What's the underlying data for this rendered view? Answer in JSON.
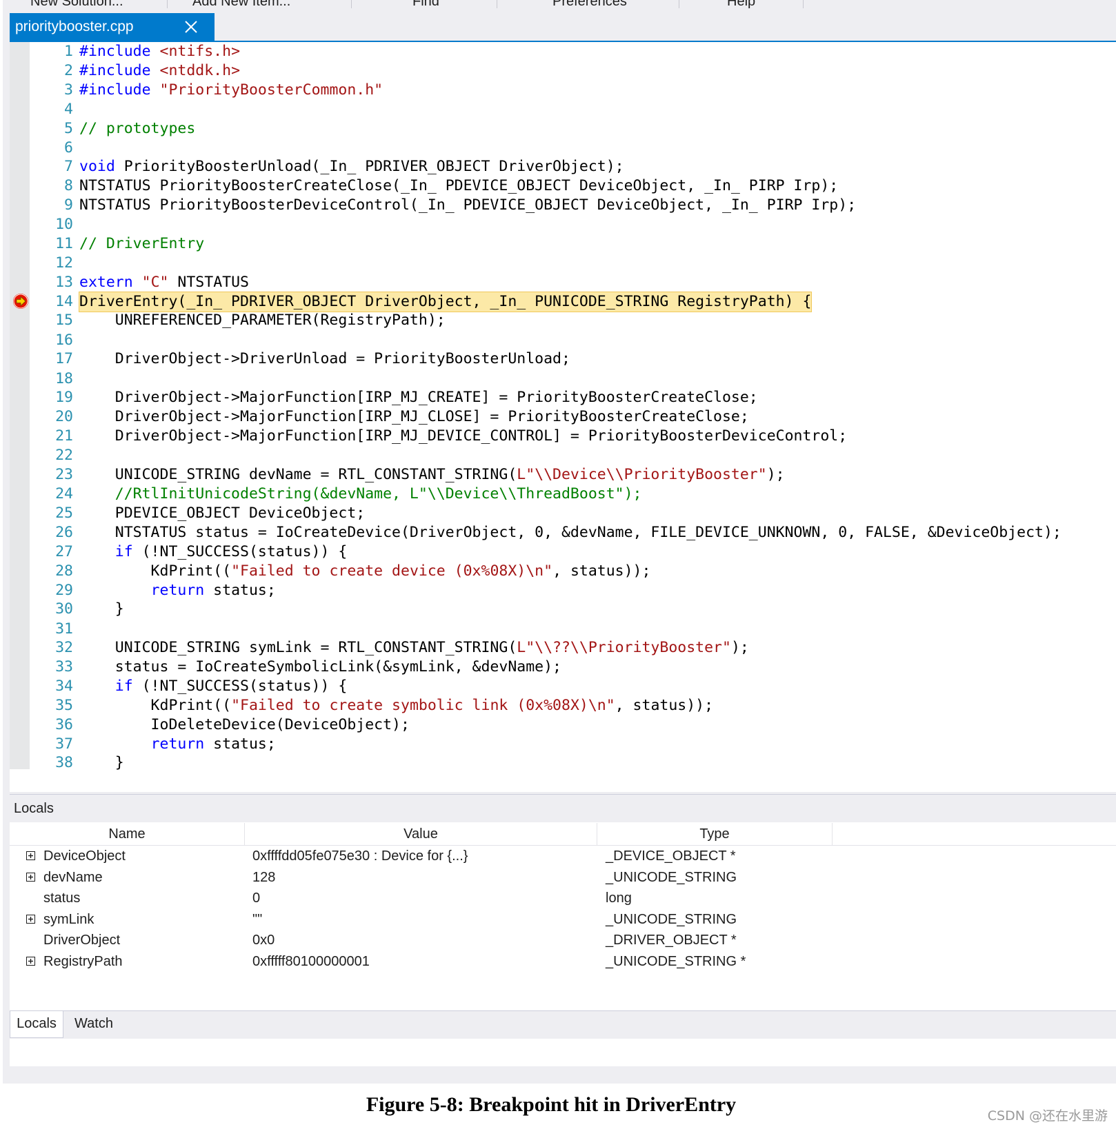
{
  "menu": {
    "items": [
      "New Solution...",
      "Add New Item...",
      "Find",
      "Preferences",
      "Help"
    ]
  },
  "editor": {
    "tab": {
      "label": "prioritybooster.cpp",
      "close_icon": "close-icon"
    },
    "breakpoint_line": 14,
    "lines": [
      {
        "n": "1",
        "tokens": [
          {
            "t": "#include",
            "c": "kw"
          },
          {
            "t": " ",
            "c": "plain"
          },
          {
            "t": "<ntifs.h>",
            "c": "str"
          }
        ]
      },
      {
        "n": "2",
        "tokens": [
          {
            "t": "#include",
            "c": "kw"
          },
          {
            "t": " ",
            "c": "plain"
          },
          {
            "t": "<ntddk.h>",
            "c": "str"
          }
        ]
      },
      {
        "n": "3",
        "tokens": [
          {
            "t": "#include",
            "c": "kw"
          },
          {
            "t": " ",
            "c": "plain"
          },
          {
            "t": "\"PriorityBoosterCommon.h\"",
            "c": "str"
          }
        ]
      },
      {
        "n": "4",
        "tokens": []
      },
      {
        "n": "5",
        "tokens": [
          {
            "t": "// prototypes",
            "c": "com"
          }
        ]
      },
      {
        "n": "6",
        "tokens": []
      },
      {
        "n": "7",
        "tokens": [
          {
            "t": "void",
            "c": "kw"
          },
          {
            "t": " PriorityBoosterUnload(_In_ PDRIVER_OBJECT DriverObject);",
            "c": "plain"
          }
        ]
      },
      {
        "n": "8",
        "tokens": [
          {
            "t": "NTSTATUS PriorityBoosterCreateClose(_In_ PDEVICE_OBJECT DeviceObject, _In_ PIRP Irp);",
            "c": "plain"
          }
        ]
      },
      {
        "n": "9",
        "tokens": [
          {
            "t": "NTSTATUS PriorityBoosterDeviceControl(_In_ PDEVICE_OBJECT DeviceObject, _In_ PIRP Irp);",
            "c": "plain"
          }
        ]
      },
      {
        "n": "10",
        "tokens": []
      },
      {
        "n": "11",
        "tokens": [
          {
            "t": "// DriverEntry",
            "c": "com"
          }
        ]
      },
      {
        "n": "12",
        "tokens": []
      },
      {
        "n": "13",
        "tokens": [
          {
            "t": "extern",
            "c": "kw"
          },
          {
            "t": " ",
            "c": "plain"
          },
          {
            "t": "\"C\"",
            "c": "str"
          },
          {
            "t": " NTSTATUS",
            "c": "plain"
          }
        ]
      },
      {
        "n": "14",
        "hl": true,
        "tokens": [
          {
            "t": "DriverEntry(_In_ PDRIVER_OBJECT DriverObject, _In_ PUNICODE_STRING RegistryPath) {",
            "c": "plain"
          }
        ]
      },
      {
        "n": "15",
        "tokens": [
          {
            "t": "    UNREFERENCED_PARAMETER(RegistryPath);",
            "c": "plain"
          }
        ]
      },
      {
        "n": "16",
        "tokens": []
      },
      {
        "n": "17",
        "tokens": [
          {
            "t": "    DriverObject->DriverUnload = PriorityBoosterUnload;",
            "c": "plain"
          }
        ]
      },
      {
        "n": "18",
        "tokens": []
      },
      {
        "n": "19",
        "tokens": [
          {
            "t": "    DriverObject->MajorFunction[IRP_MJ_CREATE] = PriorityBoosterCreateClose;",
            "c": "plain"
          }
        ]
      },
      {
        "n": "20",
        "tokens": [
          {
            "t": "    DriverObject->MajorFunction[IRP_MJ_CLOSE] = PriorityBoosterCreateClose;",
            "c": "plain"
          }
        ]
      },
      {
        "n": "21",
        "tokens": [
          {
            "t": "    DriverObject->MajorFunction[IRP_MJ_DEVICE_CONTROL] = PriorityBoosterDeviceControl;",
            "c": "plain"
          }
        ]
      },
      {
        "n": "22",
        "tokens": []
      },
      {
        "n": "23",
        "tokens": [
          {
            "t": "    UNICODE_STRING devName = RTL_CONSTANT_STRING(",
            "c": "plain"
          },
          {
            "t": "L\"\\\\Device\\\\PriorityBooster\"",
            "c": "str"
          },
          {
            "t": ");",
            "c": "plain"
          }
        ]
      },
      {
        "n": "24",
        "tokens": [
          {
            "t": "    ",
            "c": "plain"
          },
          {
            "t": "//RtlInitUnicodeString(&devName, L\"\\\\Device\\\\ThreadBoost\");",
            "c": "com"
          }
        ]
      },
      {
        "n": "25",
        "tokens": [
          {
            "t": "    PDEVICE_OBJECT DeviceObject;",
            "c": "plain"
          }
        ]
      },
      {
        "n": "26",
        "tokens": [
          {
            "t": "    NTSTATUS status = IoCreateDevice(DriverObject, 0, &devName, FILE_DEVICE_UNKNOWN, 0, FALSE, &DeviceObject);",
            "c": "plain"
          }
        ]
      },
      {
        "n": "27",
        "tokens": [
          {
            "t": "    ",
            "c": "plain"
          },
          {
            "t": "if",
            "c": "kw"
          },
          {
            "t": " (!NT_SUCCESS(status)) {",
            "c": "plain"
          }
        ]
      },
      {
        "n": "28",
        "tokens": [
          {
            "t": "        KdPrint((",
            "c": "plain"
          },
          {
            "t": "\"Failed to create device (0x%08X)\\n\"",
            "c": "str"
          },
          {
            "t": ", status));",
            "c": "plain"
          }
        ]
      },
      {
        "n": "29",
        "tokens": [
          {
            "t": "        ",
            "c": "plain"
          },
          {
            "t": "return",
            "c": "kw"
          },
          {
            "t": " status;",
            "c": "plain"
          }
        ]
      },
      {
        "n": "30",
        "tokens": [
          {
            "t": "    }",
            "c": "plain"
          }
        ]
      },
      {
        "n": "31",
        "tokens": []
      },
      {
        "n": "32",
        "tokens": [
          {
            "t": "    UNICODE_STRING symLink = RTL_CONSTANT_STRING(",
            "c": "plain"
          },
          {
            "t": "L\"\\\\??\\\\PriorityBooster\"",
            "c": "str"
          },
          {
            "t": ");",
            "c": "plain"
          }
        ]
      },
      {
        "n": "33",
        "tokens": [
          {
            "t": "    status = IoCreateSymbolicLink(&symLink, &devName);",
            "c": "plain"
          }
        ]
      },
      {
        "n": "34",
        "tokens": [
          {
            "t": "    ",
            "c": "plain"
          },
          {
            "t": "if",
            "c": "kw"
          },
          {
            "t": " (!NT_SUCCESS(status)) {",
            "c": "plain"
          }
        ]
      },
      {
        "n": "35",
        "tokens": [
          {
            "t": "        KdPrint((",
            "c": "plain"
          },
          {
            "t": "\"Failed to create symbolic link (0x%08X)\\n\"",
            "c": "str"
          },
          {
            "t": ", status));",
            "c": "plain"
          }
        ]
      },
      {
        "n": "36",
        "tokens": [
          {
            "t": "        IoDeleteDevice(DeviceObject);",
            "c": "plain"
          }
        ]
      },
      {
        "n": "37",
        "tokens": [
          {
            "t": "        ",
            "c": "plain"
          },
          {
            "t": "return",
            "c": "kw"
          },
          {
            "t": " status;",
            "c": "plain"
          }
        ]
      },
      {
        "n": "38",
        "tokens": [
          {
            "t": "    }",
            "c": "plain"
          }
        ]
      }
    ]
  },
  "locals": {
    "title": "Locals",
    "columns": {
      "name": "Name",
      "value": "Value",
      "type": "Type"
    },
    "rows": [
      {
        "expandable": true,
        "name": "DeviceObject",
        "value": "0xffffdd05fe075e30 : Device for {...}",
        "type": "_DEVICE_OBJECT *"
      },
      {
        "expandable": true,
        "name": "devName",
        "value": "128",
        "type": "_UNICODE_STRING"
      },
      {
        "expandable": false,
        "name": "status",
        "value": "0",
        "type": "long"
      },
      {
        "expandable": true,
        "name": "symLink",
        "value": "\"\"",
        "type": "_UNICODE_STRING"
      },
      {
        "expandable": false,
        "name": "DriverObject",
        "value": "0x0",
        "type": "_DRIVER_OBJECT *"
      },
      {
        "expandable": true,
        "name": "RegistryPath",
        "value": "0xfffff80100000001",
        "type": "_UNICODE_STRING *"
      }
    ]
  },
  "bottom_tabs": {
    "locals": "Locals",
    "watch": "Watch"
  },
  "caption": "Figure 5-8: Breakpoint hit in DriverEntry",
  "watermark": "CSDN @还在水里游",
  "colors": {
    "accent": "#007acc",
    "keyword": "#0000ff",
    "string": "#a31515",
    "comment": "#008000",
    "line_number": "#2b91af",
    "current_line_highlight": "#fce9a7",
    "breakpoint": "#e51400"
  }
}
